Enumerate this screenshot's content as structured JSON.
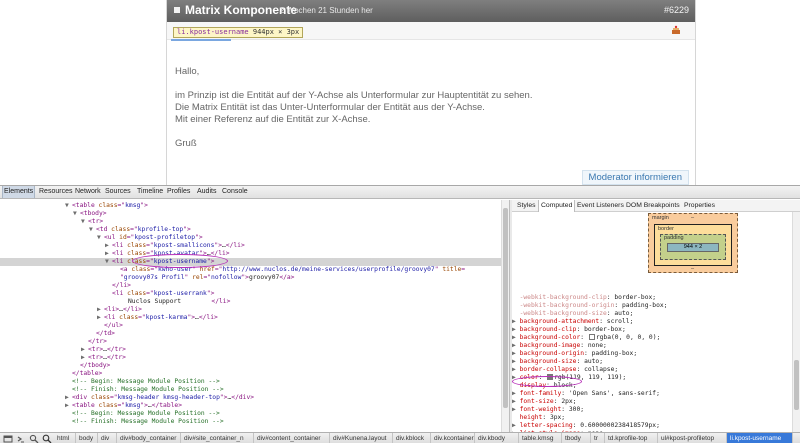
{
  "post": {
    "title": "Matrix Komponente",
    "time": "2 Wochen 21 Stunden her",
    "id": "#6229",
    "tooltip_tag": "li.kpost-username",
    "tooltip_size": "944px × 3px",
    "body": {
      "greeting": "Hallo,",
      "line1": "im Prinzip ist die Entität auf der Y-Achse als Unterformular zur Hauptentität zu sehen.",
      "line2": "Die Matrix Entität ist das Unter-Unterformular der Entität aus der Y-Achse.",
      "line3": "Mit einer Referenz auf die Entität zur X-Achse.",
      "closing": "Gruß"
    },
    "moderator_label": "Moderator informieren"
  },
  "devtools": {
    "tabs": [
      "Elements",
      "Resources",
      "Network",
      "Sources",
      "Timeline",
      "Profiles",
      "Audits",
      "Console"
    ],
    "active_tab": "Elements",
    "dom_lines": [
      {
        "i": 72,
        "t": "▼",
        "parts": [
          [
            "tag",
            "<table "
          ],
          [
            "an",
            "class"
          ],
          [
            "tag",
            "=\""
          ],
          [
            "av",
            "kmsg"
          ],
          [
            "tag",
            "\">"
          ]
        ]
      },
      {
        "i": 80,
        "t": "▼",
        "parts": [
          [
            "tag",
            "<tbody>"
          ]
        ]
      },
      {
        "i": 88,
        "t": "▼",
        "parts": [
          [
            "tag",
            "<tr>"
          ]
        ]
      },
      {
        "i": 96,
        "t": "▼",
        "parts": [
          [
            "tag",
            "<td "
          ],
          [
            "an",
            "class"
          ],
          [
            "tag",
            "=\""
          ],
          [
            "av",
            "kprofile-top"
          ],
          [
            "tag",
            "\">"
          ]
        ]
      },
      {
        "i": 104,
        "t": "▼",
        "parts": [
          [
            "tag",
            "<ul "
          ],
          [
            "an",
            "id"
          ],
          [
            "tag",
            "=\""
          ],
          [
            "av",
            "kpost-profiletop"
          ],
          [
            "tag",
            "\">"
          ]
        ]
      },
      {
        "i": 112,
        "t": "▶",
        "parts": [
          [
            "tag",
            "<li "
          ],
          [
            "an",
            "class"
          ],
          [
            "tag",
            "=\""
          ],
          [
            "av",
            "kpost-smallicons"
          ],
          [
            "tag",
            "\">"
          ],
          [
            "tx",
            "…"
          ],
          [
            "tag",
            "</li>"
          ]
        ]
      },
      {
        "i": 112,
        "t": "▶",
        "parts": [
          [
            "tag",
            "<li "
          ],
          [
            "an",
            "class"
          ],
          [
            "tag",
            "=\""
          ],
          [
            "av",
            "kpost-avatar"
          ],
          [
            "tag",
            "\">"
          ],
          [
            "tx",
            "…"
          ],
          [
            "tag",
            "</li>"
          ]
        ]
      },
      {
        "i": 112,
        "t": "▼",
        "parts": [
          [
            "tag",
            "<li "
          ],
          [
            "an",
            "class"
          ],
          [
            "tag",
            "=\""
          ],
          [
            "av",
            "kpost-username"
          ],
          [
            "tag",
            "\">"
          ]
        ],
        "sel": true
      },
      {
        "i": 120,
        "t": "",
        "parts": [
          [
            "tag",
            "<a "
          ],
          [
            "an",
            "class"
          ],
          [
            "tag",
            "=\""
          ],
          [
            "av",
            "kwho-user"
          ],
          [
            "tag",
            "\" "
          ],
          [
            "an",
            "href"
          ],
          [
            "tag",
            "=\""
          ],
          [
            "av",
            "http://www.nuclos.de/meine-services/userprofile/groovy07"
          ],
          [
            "tag",
            "\" "
          ],
          [
            "an",
            "title"
          ],
          [
            "tag",
            "="
          ]
        ]
      },
      {
        "i": 120,
        "t": "",
        "parts": [
          [
            "tag",
            "\""
          ],
          [
            "av",
            "groovy07s Profil"
          ],
          [
            "tag",
            "\" "
          ],
          [
            "an",
            "rel"
          ],
          [
            "tag",
            "=\""
          ],
          [
            "av",
            "nofollow"
          ],
          [
            "tag",
            "\">"
          ],
          [
            "tx",
            "groovy07"
          ],
          [
            "tag",
            "</a>"
          ]
        ]
      },
      {
        "i": 112,
        "t": "",
        "parts": [
          [
            "tag",
            "</li>"
          ]
        ]
      },
      {
        "i": 112,
        "t": "",
        "parts": [
          [
            "tag",
            "<li "
          ],
          [
            "an",
            "class"
          ],
          [
            "tag",
            "=\""
          ],
          [
            "av",
            "kpost-userrank"
          ],
          [
            "tag",
            "\">"
          ]
        ]
      },
      {
        "i": 128,
        "t": "",
        "parts": [
          [
            "tx",
            "Nuclos Support        "
          ],
          [
            "tag",
            "</li>"
          ]
        ]
      },
      {
        "i": 104,
        "t": "▶",
        "parts": [
          [
            "tag",
            "<li>"
          ],
          [
            "tx",
            "…"
          ],
          [
            "tag",
            "</li>"
          ]
        ]
      },
      {
        "i": 104,
        "t": "▶",
        "parts": [
          [
            "tag",
            "<li "
          ],
          [
            "an",
            "class"
          ],
          [
            "tag",
            "=\""
          ],
          [
            "av",
            "kpost-karma"
          ],
          [
            "tag",
            "\">"
          ],
          [
            "tx",
            "…"
          ],
          [
            "tag",
            "</li>"
          ]
        ]
      },
      {
        "i": 104,
        "t": "",
        "parts": [
          [
            "tag",
            "</ul>"
          ]
        ]
      },
      {
        "i": 96,
        "t": "",
        "parts": [
          [
            "tag",
            "</td>"
          ]
        ]
      },
      {
        "i": 88,
        "t": "",
        "parts": [
          [
            "tag",
            "</tr>"
          ]
        ]
      },
      {
        "i": 88,
        "t": "▶",
        "parts": [
          [
            "tag",
            "<tr>"
          ],
          [
            "tx",
            "…"
          ],
          [
            "tag",
            "</tr>"
          ]
        ]
      },
      {
        "i": 88,
        "t": "▶",
        "parts": [
          [
            "tag",
            "<tr>"
          ],
          [
            "tx",
            "…"
          ],
          [
            "tag",
            "</tr>"
          ]
        ]
      },
      {
        "i": 80,
        "t": "",
        "parts": [
          [
            "tag",
            "</tbody>"
          ]
        ]
      },
      {
        "i": 72,
        "t": "",
        "parts": [
          [
            "tag",
            "</table>"
          ]
        ]
      },
      {
        "i": 72,
        "t": "",
        "parts": [
          [
            "cm",
            "<!-- Begin: Message Module Position -->"
          ]
        ]
      },
      {
        "i": 72,
        "t": "",
        "parts": [
          [
            "cm",
            "<!-- Finish: Message Module Position -->"
          ]
        ]
      },
      {
        "i": 72,
        "t": "▶",
        "parts": [
          [
            "tag",
            "<div "
          ],
          [
            "an",
            "class"
          ],
          [
            "tag",
            "=\""
          ],
          [
            "av",
            "kmsg-header kmsg-header-top"
          ],
          [
            "tag",
            "\">"
          ],
          [
            "tx",
            "…"
          ],
          [
            "tag",
            "</div>"
          ]
        ]
      },
      {
        "i": 72,
        "t": "▶",
        "parts": [
          [
            "tag",
            "<table "
          ],
          [
            "an",
            "class"
          ],
          [
            "tag",
            "=\""
          ],
          [
            "av",
            "kmsg"
          ],
          [
            "tag",
            "\">"
          ],
          [
            "tx",
            "…"
          ],
          [
            "tag",
            "</table>"
          ]
        ]
      },
      {
        "i": 72,
        "t": "",
        "parts": [
          [
            "cm",
            "<!-- Begin: Message Module Position -->"
          ]
        ]
      },
      {
        "i": 72,
        "t": "",
        "parts": [
          [
            "cm",
            "<!-- Finish: Message Module Position -->"
          ]
        ]
      }
    ],
    "side_tabs": [
      "Styles",
      "Computed",
      "Event Listeners",
      "DOM Breakpoints",
      "Properties"
    ],
    "active_side_tab": "Computed",
    "box_model": {
      "margin": "margin",
      "border": "border",
      "padding": "padding",
      "content": "944 × 2",
      "dash": "–"
    },
    "css_lines": [
      {
        "t": "",
        "inh": true,
        "name": "-webkit-background-clip",
        "value": "border-box;"
      },
      {
        "t": "",
        "inh": true,
        "name": "-webkit-background-origin",
        "value": "padding-box;"
      },
      {
        "t": "",
        "inh": true,
        "name": "-webkit-background-size",
        "value": "auto;"
      },
      {
        "t": "▶",
        "name": "background-attachment",
        "value": "scroll;"
      },
      {
        "t": "▶",
        "name": "background-clip",
        "value": "border-box;"
      },
      {
        "t": "▶",
        "name": "background-color",
        "value": "rgba(0, 0, 0, 0);",
        "swatch": "#ffffff"
      },
      {
        "t": "▶",
        "name": "background-image",
        "value": "none;"
      },
      {
        "t": "▶",
        "name": "background-origin",
        "value": "padding-box;"
      },
      {
        "t": "▶",
        "name": "background-size",
        "value": "auto;"
      },
      {
        "t": "▶",
        "name": "border-collapse",
        "value": "collapse;"
      },
      {
        "t": "▶",
        "name": "color",
        "value": "rgb(119, 119, 119);",
        "swatch": "#777777"
      },
      {
        "t": "",
        "name": "display",
        "value": "block;"
      },
      {
        "t": "▶",
        "name": "font-family",
        "value": "'Open Sans', sans-serif;"
      },
      {
        "t": "▶",
        "name": "font-size",
        "value": "2px;"
      },
      {
        "t": "▶",
        "name": "font-weight",
        "value": "300;"
      },
      {
        "t": "",
        "name": "height",
        "value": "3px;"
      },
      {
        "t": "▶",
        "name": "letter-spacing",
        "value": "0.6000000238418579px;"
      },
      {
        "t": "▶",
        "name": "list-style-image",
        "value": "none;"
      }
    ],
    "breadcrumbs": [
      "html",
      "body",
      "div",
      "div#body_container",
      "div#site_container_n",
      "div#content_container",
      "div#Kunena.layout",
      "div.kblock",
      "div.kcontainer",
      "div.kbody",
      "table.kmsg",
      "tbody",
      "tr",
      "td.kprofile-top",
      "ul#kpost-profiletop",
      "li.kpost-username"
    ],
    "active_crumb": "li.kpost-username"
  },
  "colors": {
    "accent": "#3879d9",
    "annotation": "#b72fb8",
    "header": "#6a6a6a"
  }
}
